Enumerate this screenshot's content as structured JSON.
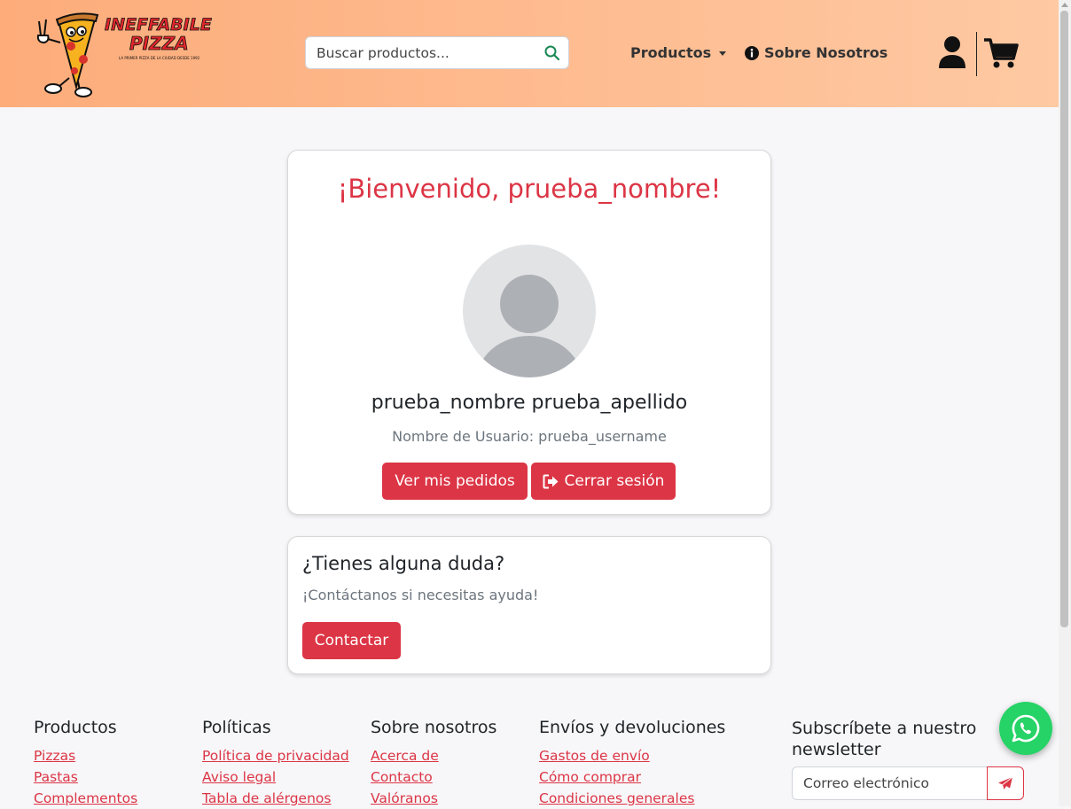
{
  "header": {
    "logo_text": "INEFFABILE PIZZA",
    "logo_tagline": "LA PRIMER PIZZA DE LA CIUDAD DESDE 1992",
    "search_placeholder": "Buscar productos...",
    "nav": {
      "productos": "Productos",
      "sobre_nosotros": "Sobre Nosotros"
    }
  },
  "profile": {
    "welcome": "¡Bienvenido, prueba_nombre!",
    "full_name": "prueba_nombre prueba_apellido",
    "username_line": "Nombre de Usuario: prueba_username",
    "orders_button": "Ver mis pedidos",
    "logout_button": "Cerrar sesión"
  },
  "help": {
    "title": "¿Tienes alguna duda?",
    "text": "¡Contáctanos si necesitas ayuda!",
    "button": "Contactar"
  },
  "footer": {
    "columns": [
      {
        "title": "Productos",
        "links": [
          "Pizzas",
          "Pastas",
          "Complementos"
        ]
      },
      {
        "title": "Políticas",
        "links": [
          "Política de privacidad",
          "Aviso legal",
          "Tabla de alérgenos"
        ]
      },
      {
        "title": "Sobre nosotros",
        "links": [
          "Acerca de",
          "Contacto",
          "Valóranos"
        ]
      },
      {
        "title": "Envíos y devoluciones",
        "links": [
          "Gastos de envío",
          "Cómo comprar",
          "Condiciones generales"
        ]
      }
    ],
    "newsletter": {
      "title": "Subscríbete a nuestro newsletter",
      "placeholder": "Correo electrónico"
    }
  },
  "colors": {
    "brand_red": "#dc3545",
    "header_gradient_start": "#fdac7a",
    "header_gradient_end": "#fec9a3",
    "whatsapp_green": "#25d366"
  },
  "icons": [
    "search-icon",
    "chevron-down-icon",
    "info-icon",
    "user-icon",
    "cart-icon",
    "avatar-icon",
    "sign-out-icon",
    "send-icon",
    "whatsapp-icon"
  ]
}
